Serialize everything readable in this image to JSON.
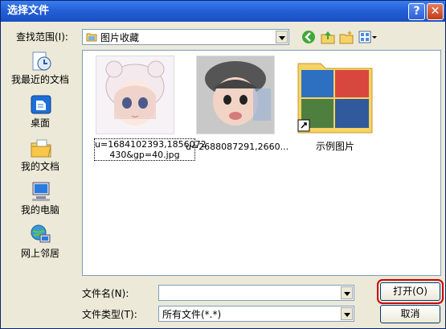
{
  "window": {
    "title": "选择文件",
    "help_glyph": "?",
    "close_glyph": "✕"
  },
  "toolbar": {
    "lookin_label": "查找范围(I):",
    "lookin_value": "图片收藏"
  },
  "places": [
    {
      "label": "我最近的文档",
      "icon": "recent-documents-icon"
    },
    {
      "label": "桌面",
      "icon": "desktop-icon"
    },
    {
      "label": "我的文档",
      "icon": "my-documents-icon"
    },
    {
      "label": "我的电脑",
      "icon": "my-computer-icon"
    },
    {
      "label": "网上邻居",
      "icon": "network-places-icon"
    }
  ],
  "files": [
    {
      "name_line1": "u=1684102393,1856072",
      "name_line2": "430&gp=40.jpg"
    },
    {
      "name": "u=2688087291,2660..."
    },
    {
      "name": "示例图片"
    }
  ],
  "bottom": {
    "filename_label": "文件名(N):",
    "filename_value": "",
    "filetype_label": "文件类型(T):",
    "filetype_value": "所有文件(*.*)",
    "open_label": "打开(O)",
    "cancel_label": "取消"
  },
  "colors": {
    "titlebar": "#2460d6",
    "dialog_bg": "#ece9d8",
    "focus_outline": "#cc0000"
  }
}
